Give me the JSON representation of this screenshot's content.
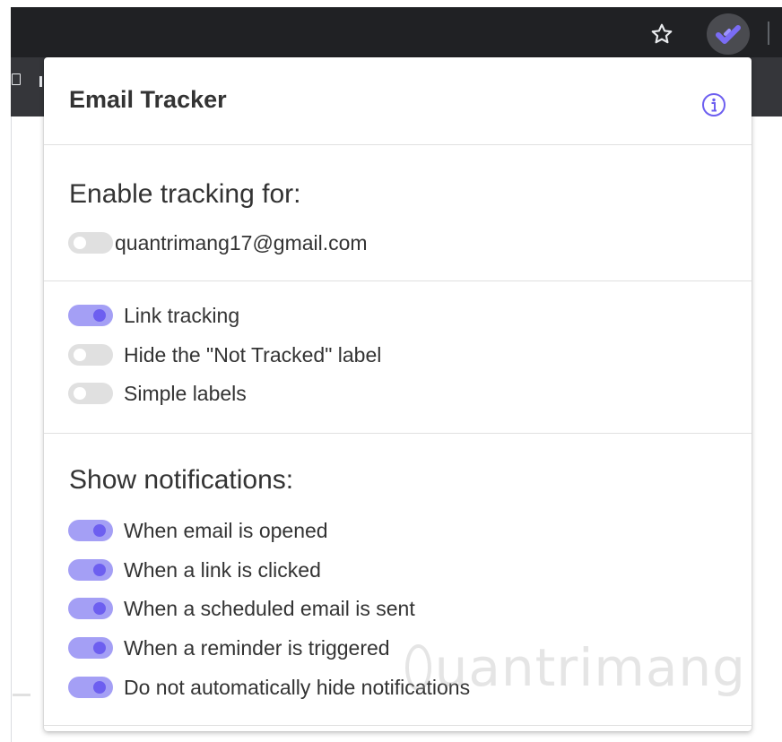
{
  "browser": {
    "star_icon": "star-outline-icon",
    "extension_icon": "email-tracker-checkmark-icon",
    "extension_color": "#7a6cf5"
  },
  "popup": {
    "title": "Email Tracker",
    "info_icon": "info-circle-icon",
    "accent_color": "#6d5ff0",
    "toggle_on_color": "#a49ff5",
    "toggle_off_color": "#e0e0e0",
    "enable_section": {
      "heading": "Enable tracking for:",
      "accounts": [
        {
          "label": "quantrimang17@gmail.com",
          "enabled": false
        }
      ]
    },
    "options_section": {
      "items": [
        {
          "label": "Link tracking",
          "enabled": true
        },
        {
          "label": "Hide the \"Not Tracked\" label",
          "enabled": false
        },
        {
          "label": "Simple labels",
          "enabled": false
        }
      ]
    },
    "notifications_section": {
      "heading": "Show notifications:",
      "items": [
        {
          "label": "When email is opened",
          "enabled": true
        },
        {
          "label": "When a link is clicked",
          "enabled": true
        },
        {
          "label": "When a scheduled email is sent",
          "enabled": true
        },
        {
          "label": "When a reminder is triggered",
          "enabled": true
        },
        {
          "label": "Do not automatically hide notifications",
          "enabled": true
        }
      ]
    }
  },
  "watermark": {
    "text": "uantrimang"
  }
}
